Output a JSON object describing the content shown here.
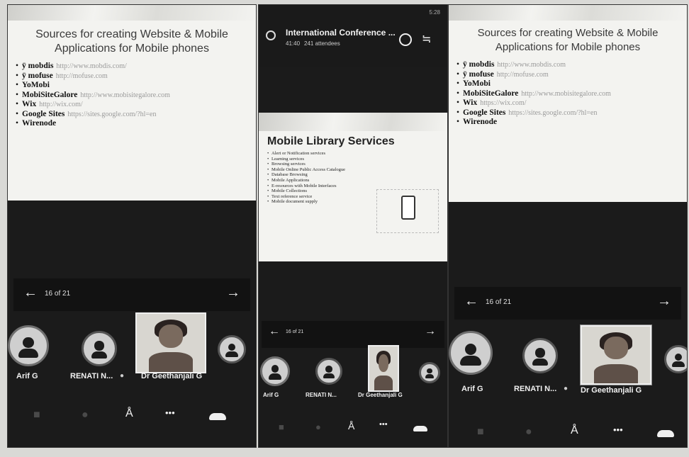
{
  "left": {
    "slide": {
      "title_line1": "Sources for creating Website & Mobile",
      "title_line2": "Applications for Mobile phones",
      "items": [
        {
          "name": "ÿ mobdis",
          "url": "http://www.mobdis.com/"
        },
        {
          "name": "ÿ mofuse",
          "url": "http://mofuse.com"
        },
        {
          "name": "YoMobi",
          "url": ""
        },
        {
          "name": "MobiSiteGalore",
          "url": "http://www.mobisitegalore.com"
        },
        {
          "name": "Wix",
          "url": "http://wix.com/"
        },
        {
          "name": "Google Sites",
          "url": "https://sites.google.com/?hl=en"
        },
        {
          "name": "Wirenode",
          "url": ""
        }
      ]
    },
    "pager": {
      "counter": "16 of 21",
      "prev_icon": "arrow-left-icon",
      "next_icon": "arrow-right-icon"
    },
    "participants": [
      "Arif G",
      "RENATI N...",
      "Dr Geethanjali G"
    ]
  },
  "middle": {
    "meeting": {
      "title": "International Conference ...",
      "time": "41:40",
      "attendees": "241 attendees",
      "status": "5:28"
    },
    "slide": {
      "title": "Mobile Library Services",
      "items": [
        "Alert or Notification services",
        "Learning services",
        "Browsing services",
        "Mobile Online Public Access Catalogue",
        "Database Browsing",
        "Mobile Applications",
        "E-resources with Mobile Interfaces",
        "Mobile Collections",
        "Text reference service",
        "Mobile document supply"
      ]
    },
    "pager": {
      "counter": "16 of 21"
    },
    "participants": [
      "Arif G",
      "RENATI N...",
      "Dr Geethanjali G"
    ]
  },
  "right": {
    "slide": {
      "title_line1": "Sources for creating Website & Mobile",
      "title_line2": "Applications for Mobile phones",
      "items": [
        {
          "name": "ÿ mobdis",
          "url": "http://www.mobdis.com"
        },
        {
          "name": "ÿ mofuse",
          "url": "http://mofuse.com"
        },
        {
          "name": "YoMobi",
          "url": ""
        },
        {
          "name": "MobiSiteGalore",
          "url": "http://www.mobisitegalore.com"
        },
        {
          "name": "Wix",
          "url": "https://wix.com/"
        },
        {
          "name": "Google Sites",
          "url": "https://sites.google.com/?hl=en"
        },
        {
          "name": "Wirenode",
          "url": ""
        }
      ]
    },
    "pager": {
      "counter": "16 of 21"
    },
    "participants": [
      "Arif G",
      "RENATI N...",
      "Dr Geethanjali G"
    ]
  },
  "controls": {
    "more": "•••"
  },
  "colors": {
    "background": "#1b1b1b",
    "slide": "#f3f3f0",
    "paper": "#d9d9d6"
  }
}
